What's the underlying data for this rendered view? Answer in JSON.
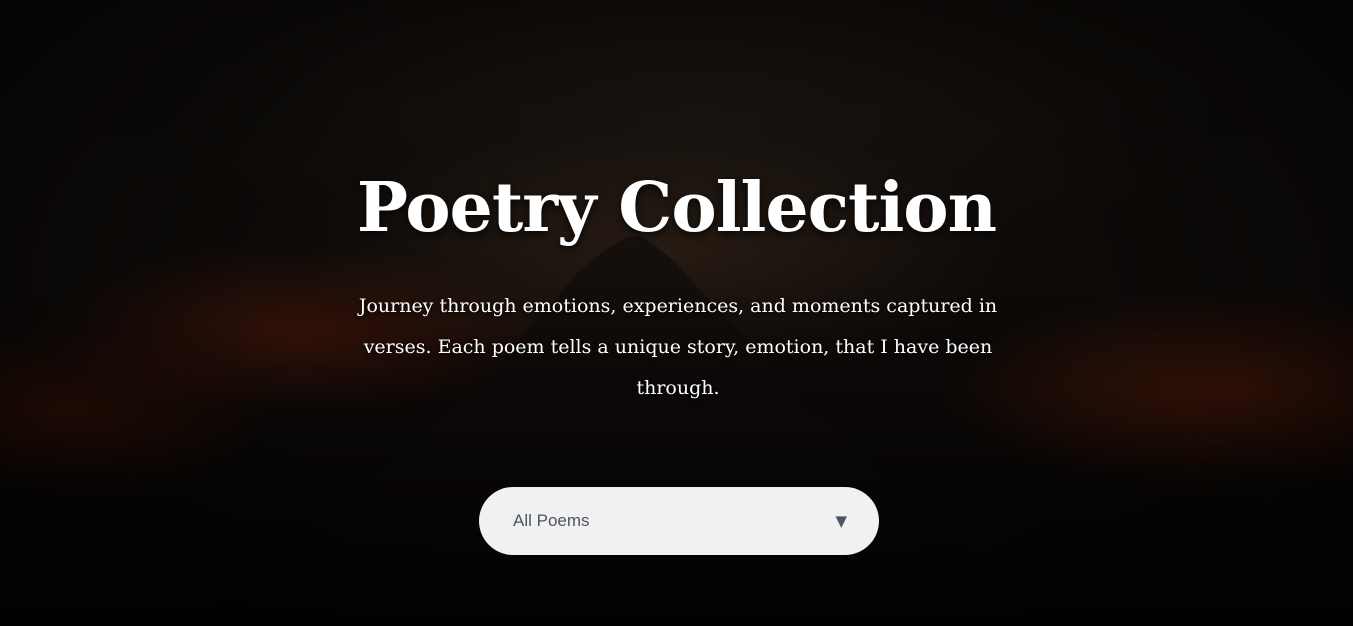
{
  "hero": {
    "title": "Poetry Collection",
    "subtitle": "Journey through emotions, experiences, and moments captured in verses. Each poem tells a unique story, emotion, that I have been through."
  },
  "filter": {
    "selected": "All Poems",
    "arrow_icon": "triangle-down-icon"
  },
  "colors": {
    "title_text": "#ffffff",
    "select_background": "#f1f1f1",
    "select_text": "#4b5563"
  }
}
